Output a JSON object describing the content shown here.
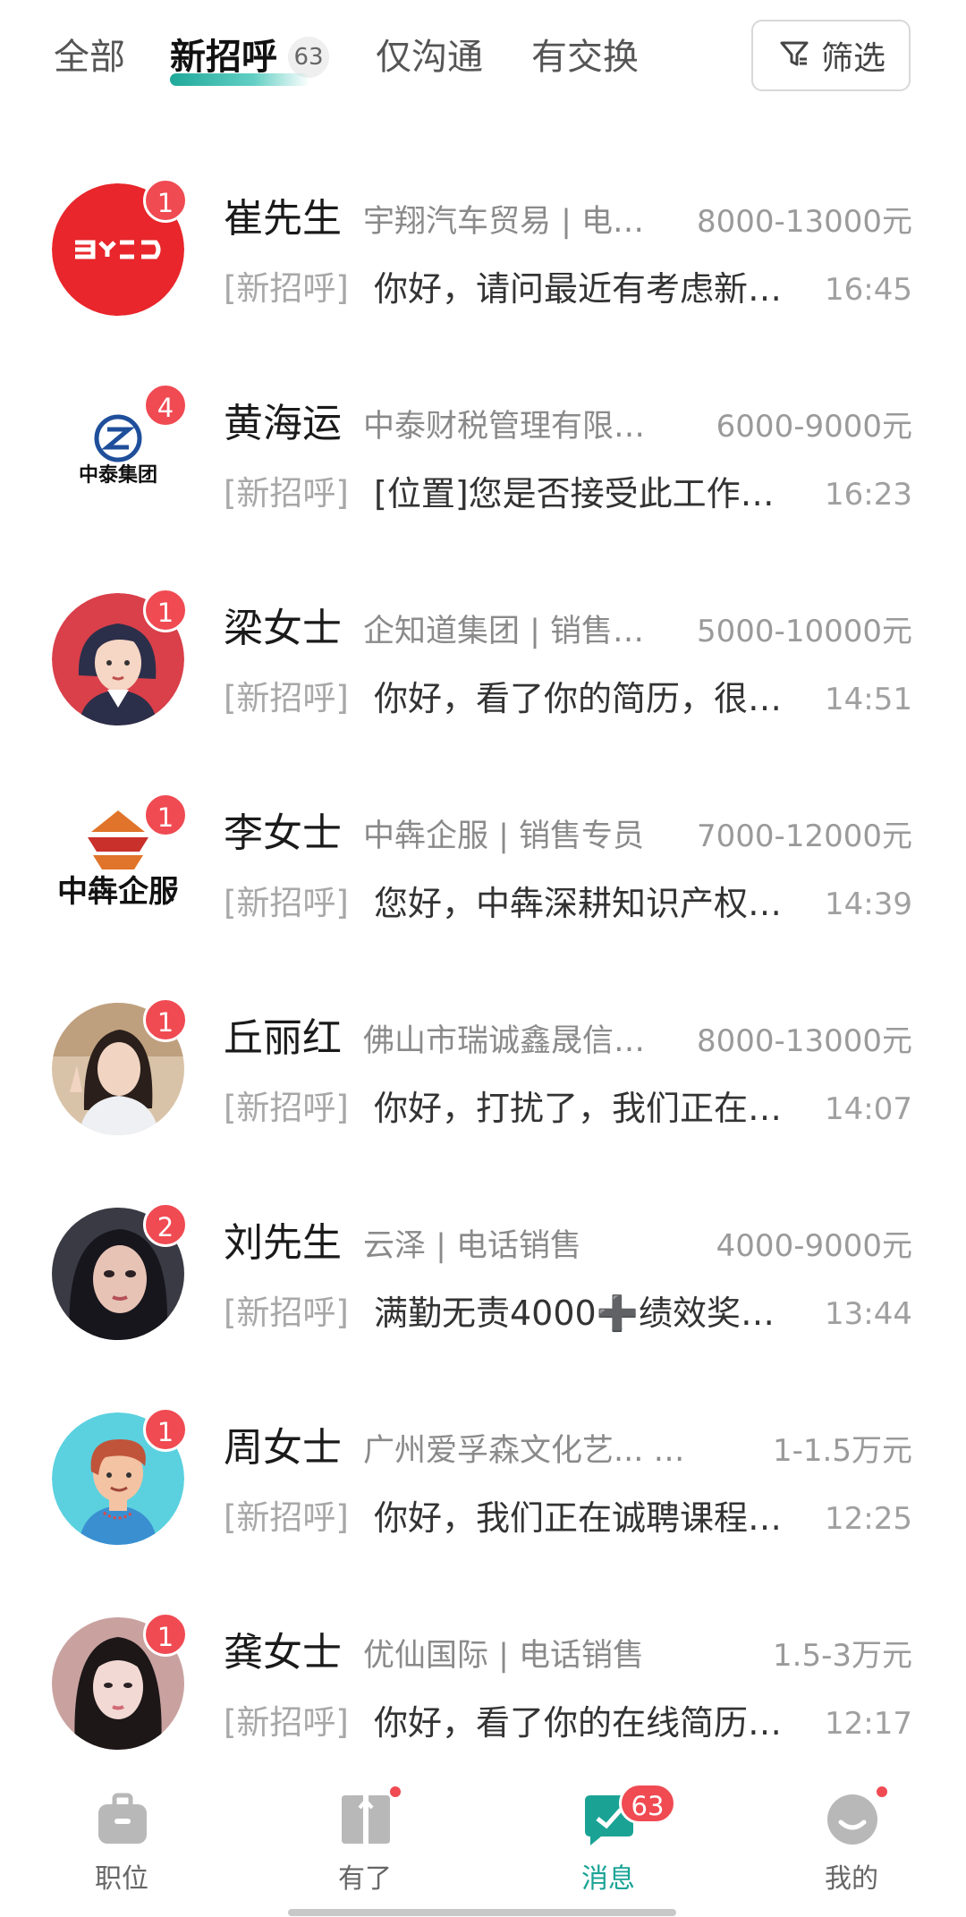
{
  "tabs": {
    "all": "全部",
    "new_greeting": "新招呼",
    "new_greeting_count": "63",
    "chat_only": "仅沟通",
    "exchanged": "有交换",
    "filter": "筛选"
  },
  "messages": [
    {
      "name": "崔先生",
      "company": "宇翔汽车贸易 | 电…",
      "salary": "8000-13000元",
      "tag": "[新招呼]",
      "preview": "你好，请问最近有考虑新…",
      "time": "16:45",
      "unread": "1",
      "avatar_icon": "byd-logo-icon"
    },
    {
      "name": "黄海运",
      "company": "中泰财税管理有限…",
      "salary": "6000-9000元",
      "tag": "[新招呼]",
      "preview": "[位置]您是否接受此工作…",
      "time": "16:23",
      "unread": "4",
      "avatar_icon": "zhongtai-logo-icon",
      "logo_text": "中泰集团"
    },
    {
      "name": "梁女士",
      "company": "企知道集团 | 销售…",
      "salary": "5000-10000元",
      "tag": "[新招呼]",
      "preview": "你好，看了你的简历，很…",
      "time": "14:51",
      "unread": "1",
      "avatar_icon": "woman-cartoon-avatar-icon"
    },
    {
      "name": "李女士",
      "company": "中犇企服 | 销售专员",
      "salary": "7000-12000元",
      "tag": "[新招呼]",
      "preview": "您好，中犇深耕知识产权…",
      "time": "14:39",
      "unread": "1",
      "avatar_icon": "zhongben-logo-icon",
      "logo_text": "中犇企服"
    },
    {
      "name": "丘丽红",
      "company": "佛山市瑞诚鑫晟信…",
      "salary": "8000-13000元",
      "tag": "[新招呼]",
      "preview": "你好，打扰了，我们正在…",
      "time": "14:07",
      "unread": "1",
      "avatar_icon": "photo-avatar-icon"
    },
    {
      "name": "刘先生",
      "company": "云泽 | 电话销售",
      "salary": "4000-9000元",
      "tag": "[新招呼]",
      "preview": "满勤无责4000➕绩效奖…",
      "time": "13:44",
      "unread": "2",
      "avatar_icon": "photo-avatar-icon"
    },
    {
      "name": "周女士",
      "company": "广州爱孚森文化艺... |…",
      "salary": "1-1.5万元",
      "tag": "[新招呼]",
      "preview": "你好，我们正在诚聘课程…",
      "time": "12:25",
      "unread": "1",
      "avatar_icon": "man-cartoon-avatar-icon"
    },
    {
      "name": "龚女士",
      "company": "优仙国际 | 电话销售",
      "salary": "1.5-3万元",
      "tag": "[新招呼]",
      "preview": "你好，看了你的在线简历…",
      "time": "12:17",
      "unread": "1",
      "avatar_icon": "photo-avatar-icon"
    }
  ],
  "nav": {
    "jobs": "职位",
    "youle": "有了",
    "messages": "消息",
    "messages_badge": "63",
    "mine": "我的"
  },
  "colors": {
    "accent": "#1aa395",
    "badge": "#f04a52"
  }
}
